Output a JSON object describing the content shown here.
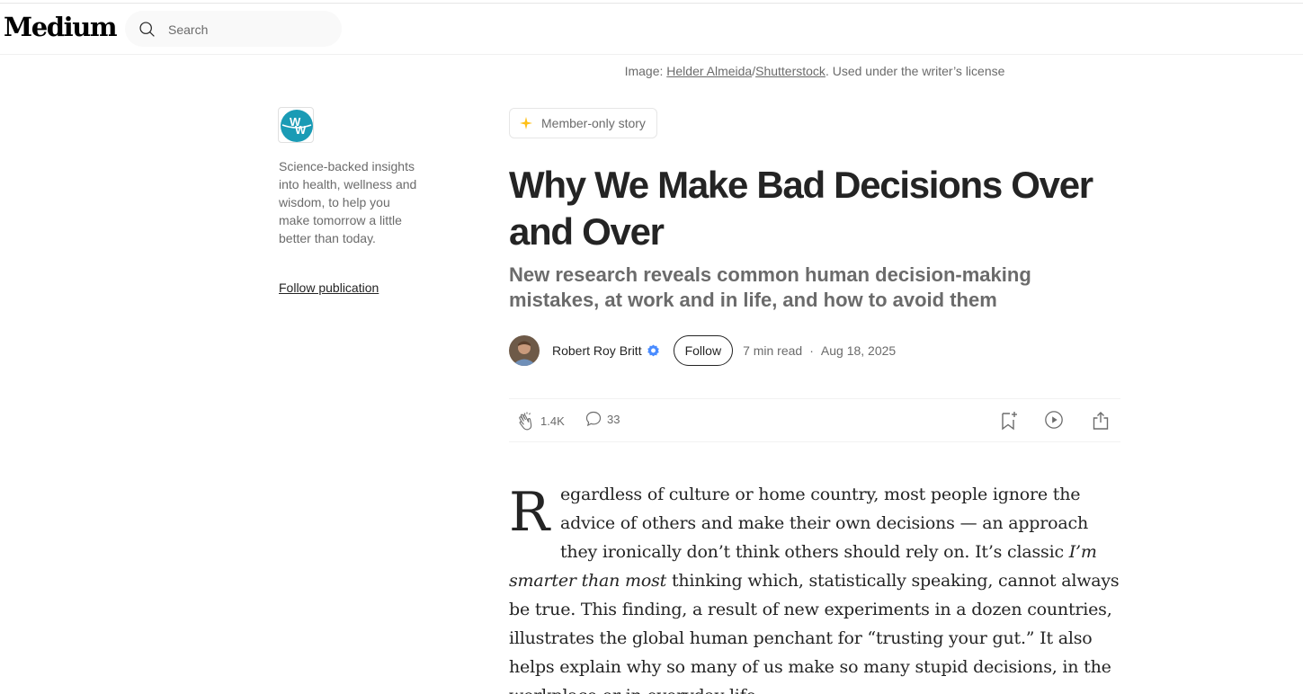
{
  "brand": {
    "logo_text": "Medium"
  },
  "search": {
    "placeholder": "Search"
  },
  "image_caption": {
    "prefix": "Image: ",
    "credit_1": "Helder Almeida",
    "separator": "/",
    "credit_2": "Shutterstock",
    "suffix": ". Used under the writer’s license"
  },
  "publication": {
    "logo_letters": "WW",
    "description": "Science-backed insights into health, wellness and wisdom, to help you make tomorrow a little better than today.",
    "follow_label": "Follow publication"
  },
  "article": {
    "badge": "Member-only story",
    "title": "Why We Make Bad Decisions Over and Over",
    "subtitle": "New research reveals common human decision-making mistakes, at work and in life, and how to avoid them",
    "author": "Robert Roy Britt",
    "follow_label": "Follow",
    "read_time": "7 min read",
    "date": "Aug 18, 2025",
    "claps": "1.4K",
    "responses": "33",
    "dropcap": "R",
    "body_part1": "egardless of culture or home country, most people ignore the advice of others and make their own decisions — an approach they ironically don’t think others should rely on. It’s classic ",
    "body_italic": "I’m smarter than most",
    "body_part2": " thinking which, statistically speaking, cannot always be true. This finding, a result of new experiments in a dozen countries, illustrates the global human penchant for “trusting your gut.” It also helps explain why so many of us make so many stupid decisions, in the workplace or in everyday life."
  },
  "icons": {
    "search": "search-icon",
    "star": "star-icon",
    "verified": "verified-badge-icon",
    "clap": "clap-icon",
    "response": "speech-bubble-icon",
    "bookmark": "bookmark-add-icon",
    "listen": "play-circle-icon",
    "share": "share-icon"
  },
  "colors": {
    "text": "#242424",
    "muted": "#6b6b6b",
    "star": "#FFC017",
    "verified": "#4A8CFF",
    "publication_teal": "#1A9BB5"
  }
}
